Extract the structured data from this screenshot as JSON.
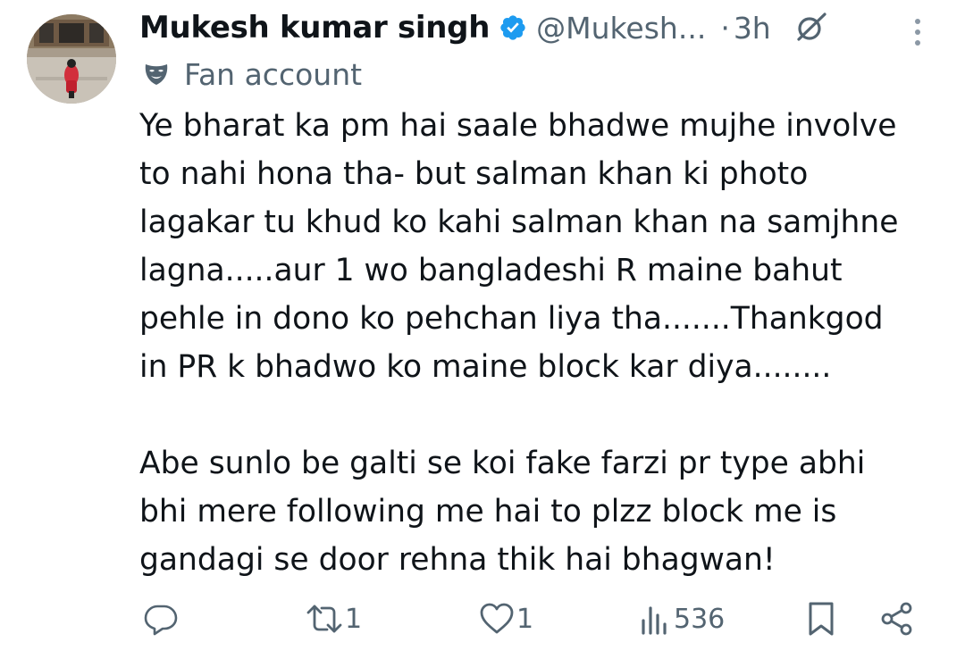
{
  "tweet": {
    "display_name": "Mukesh kumar singh",
    "handle": "@Mukesh...",
    "separator": "·",
    "time": "3h",
    "label": "Fan account",
    "text": "Ye bharat ka pm hai saale bhadwe mujhe involve\nto nahi hona tha- but salman khan ki photo\nlagakar tu khud ko kahi salman khan na samjhne\nlagna.....aur 1 wo bangladeshi R maine bahut\npehle in dono ko pehchan liya tha.......Thankgod\nin PR k bhadwo ko maine block kar diya........\n\nAbe sunlo be galti se koi fake farzi pr type abhi\nbhi mere following me hai to plzz block me is\ngandagi se door rehna thik hai bhagwan!"
  },
  "actions": {
    "reply_count": "",
    "retweet_count": "1",
    "like_count": "1",
    "views_count": "536"
  },
  "icons": {
    "verified": "verified-badge-icon",
    "grok": "grok-icon",
    "more": "more-vertical-icon",
    "label": "fan-account-mask-icon",
    "reply": "reply-icon",
    "retweet": "retweet-icon",
    "like": "like-icon",
    "views": "views-icon",
    "bookmark": "bookmark-icon",
    "share": "share-icon"
  },
  "colors": {
    "text_primary": "#0f1419",
    "text_secondary": "#536471",
    "verified_blue": "#1d9bf0"
  }
}
